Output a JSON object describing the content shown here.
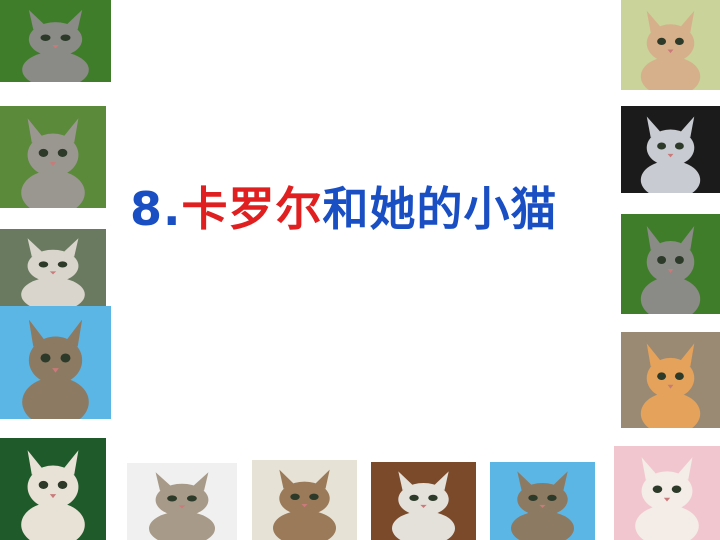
{
  "slide": {
    "title_number": "8.",
    "title_red": "卡罗尔",
    "title_blue": "和她的小猫"
  },
  "photos": [
    {
      "id": "kitten-photo-top-left",
      "bg": "#3f7d2a",
      "fur": "#8a8a86"
    },
    {
      "id": "kitten-photo-left-2",
      "bg": "#5a8a3a",
      "fur": "#9a9690"
    },
    {
      "id": "kitten-photo-left-3",
      "bg": "#6a7a60",
      "fur": "#d9d4cc"
    },
    {
      "id": "kitten-photo-left-4",
      "bg": "#5bb6e6",
      "fur": "#8c7a62"
    },
    {
      "id": "kitten-photo-bottom-left",
      "bg": "#1f5a2a",
      "fur": "#e8e2d6"
    },
    {
      "id": "kitten-photo-top-right",
      "bg": "#c9d39a",
      "fur": "#d6b08a"
    },
    {
      "id": "kitten-photo-right-2",
      "bg": "#1b1b1b",
      "fur": "#c8ccd2"
    },
    {
      "id": "kitten-photo-right-3",
      "bg": "#3f7d2a",
      "fur": "#8a8a86"
    },
    {
      "id": "kitten-photo-right-4",
      "bg": "#9a8a74",
      "fur": "#e5a25a"
    },
    {
      "id": "kitten-photo-bottom-right",
      "bg": "#f2c6cf",
      "fur": "#f4ece6"
    },
    {
      "id": "kitten-photo-bottom-1",
      "bg": "#f0f0f0",
      "fur": "#a89a88"
    },
    {
      "id": "kitten-photo-bottom-2",
      "bg": "#e6e2d6",
      "fur": "#9a7a58"
    },
    {
      "id": "kitten-photo-bottom-3",
      "bg": "#7a4a2a",
      "fur": "#e4e0da"
    },
    {
      "id": "kitten-photo-bottom-4",
      "bg": "#5bb6e6",
      "fur": "#8c7a62"
    }
  ]
}
